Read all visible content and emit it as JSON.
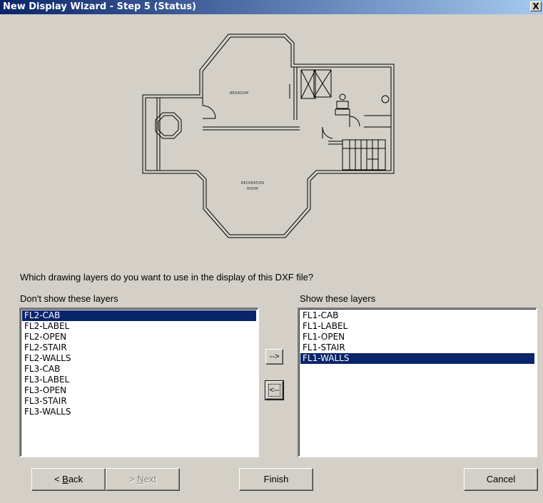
{
  "window": {
    "title": "New Display Wizard - Step 5 (Status)",
    "close_label": "X"
  },
  "preview": {
    "room_bedroom": "BEDROOM",
    "room_recreation_line1": "RECREATION",
    "room_recreation_line2": "ROOM"
  },
  "question": "Which drawing layers do you want to use in the display of this DXF file?",
  "left_list": {
    "label": "Don't show these layers",
    "items": [
      "FL2-CAB",
      "FL2-LABEL",
      "FL2-OPEN",
      "FL2-STAIR",
      "FL2-WALLS",
      "FL3-CAB",
      "FL3-LABEL",
      "FL3-OPEN",
      "FL3-STAIR",
      "FL3-WALLS"
    ],
    "selected": "FL2-CAB"
  },
  "right_list": {
    "label": "Show these layers",
    "items": [
      "FL1-CAB",
      "FL1-LABEL",
      "FL1-OPEN",
      "FL1-STAIR",
      "FL1-WALLS"
    ],
    "selected": "FL1-WALLS"
  },
  "buttons": {
    "add": "-->",
    "remove": "<--",
    "back_prefix": "< ",
    "back_mnemonic": "B",
    "back_rest": "ack",
    "next_prefix": "> ",
    "next_mnemonic": "N",
    "next_rest": "ext",
    "finish": "Finish",
    "cancel": "Cancel"
  },
  "colors": {
    "face": "#d4d0c8",
    "selection": "#0a246a",
    "title_start": "#0a246a",
    "title_end": "#a6caf0"
  }
}
